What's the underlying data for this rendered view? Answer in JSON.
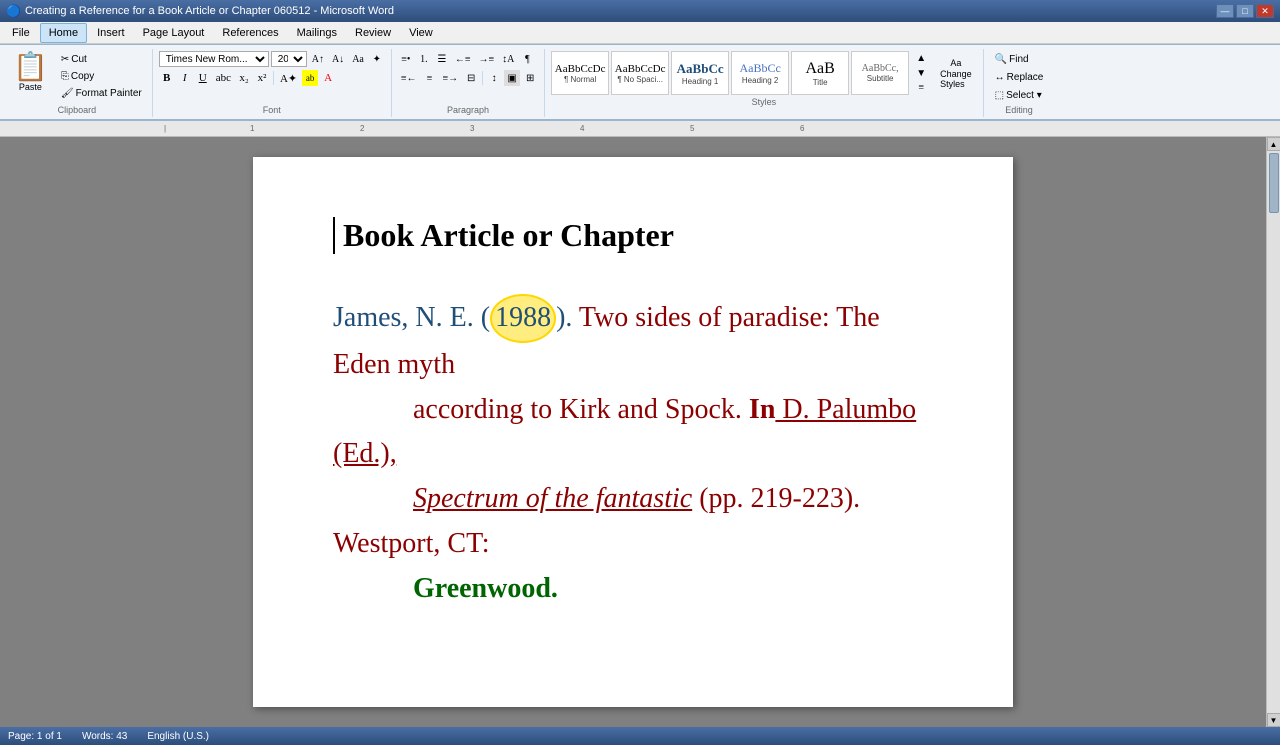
{
  "titleBar": {
    "icon": "W",
    "title": "Creating a Reference for a Book Article or Chapter 060512 - Microsoft Word",
    "controls": [
      "—",
      "□",
      "✕"
    ]
  },
  "menuBar": {
    "items": [
      "File",
      "Home",
      "Insert",
      "Page Layout",
      "References",
      "Mailings",
      "Review",
      "View"
    ]
  },
  "ribbon": {
    "activeTab": "Home",
    "clipboard": {
      "paste": "Paste",
      "cut": "Cut",
      "copy": "Copy",
      "formatPainter": "Format Painter",
      "groupLabel": "Clipboard"
    },
    "font": {
      "fontName": "Times New Rom...",
      "fontSize": "20",
      "groupLabel": "Font"
    },
    "paragraph": {
      "groupLabel": "Paragraph"
    },
    "styles": {
      "items": [
        {
          "preview": "AaBbCcDc",
          "name": "¶ Normal"
        },
        {
          "preview": "AaBbCcDc",
          "name": "¶ No Spaci..."
        },
        {
          "preview": "AaBbCc",
          "name": "Heading 1"
        },
        {
          "preview": "AaBbCc",
          "name": "Heading 2"
        },
        {
          "preview": "AaB",
          "name": "Title"
        },
        {
          "preview": "AaBbCc,",
          "name": "Subtitle"
        }
      ],
      "groupLabel": "Styles"
    },
    "editing": {
      "find": "Find",
      "replace": "Replace",
      "select": "Select ▾",
      "groupLabel": "Editing"
    }
  },
  "document": {
    "title": "Book Article or Chapter",
    "reference": {
      "part1_author": "James, N. E. ",
      "part2_paren_open": "(",
      "part3_year": "1988",
      "part4_paren_close": ").",
      "part5_title": " Two sides of paradise: The Eden myth",
      "part6_continuation": "according to Kirk and Spock.",
      "part7_in": " In",
      "part8_editor": " D. Palumbo (Ed.),",
      "part9_book": "Spectrum of the fantastic",
      "part10_pages": " (pp. 219-223).",
      "part11_publisher": " Westport, CT:",
      "part12_publisher2": "Greenwood."
    }
  },
  "statusBar": {
    "pageInfo": "Page: 1 of 1",
    "wordCount": "Words: 43",
    "language": "English (U.S.)"
  }
}
